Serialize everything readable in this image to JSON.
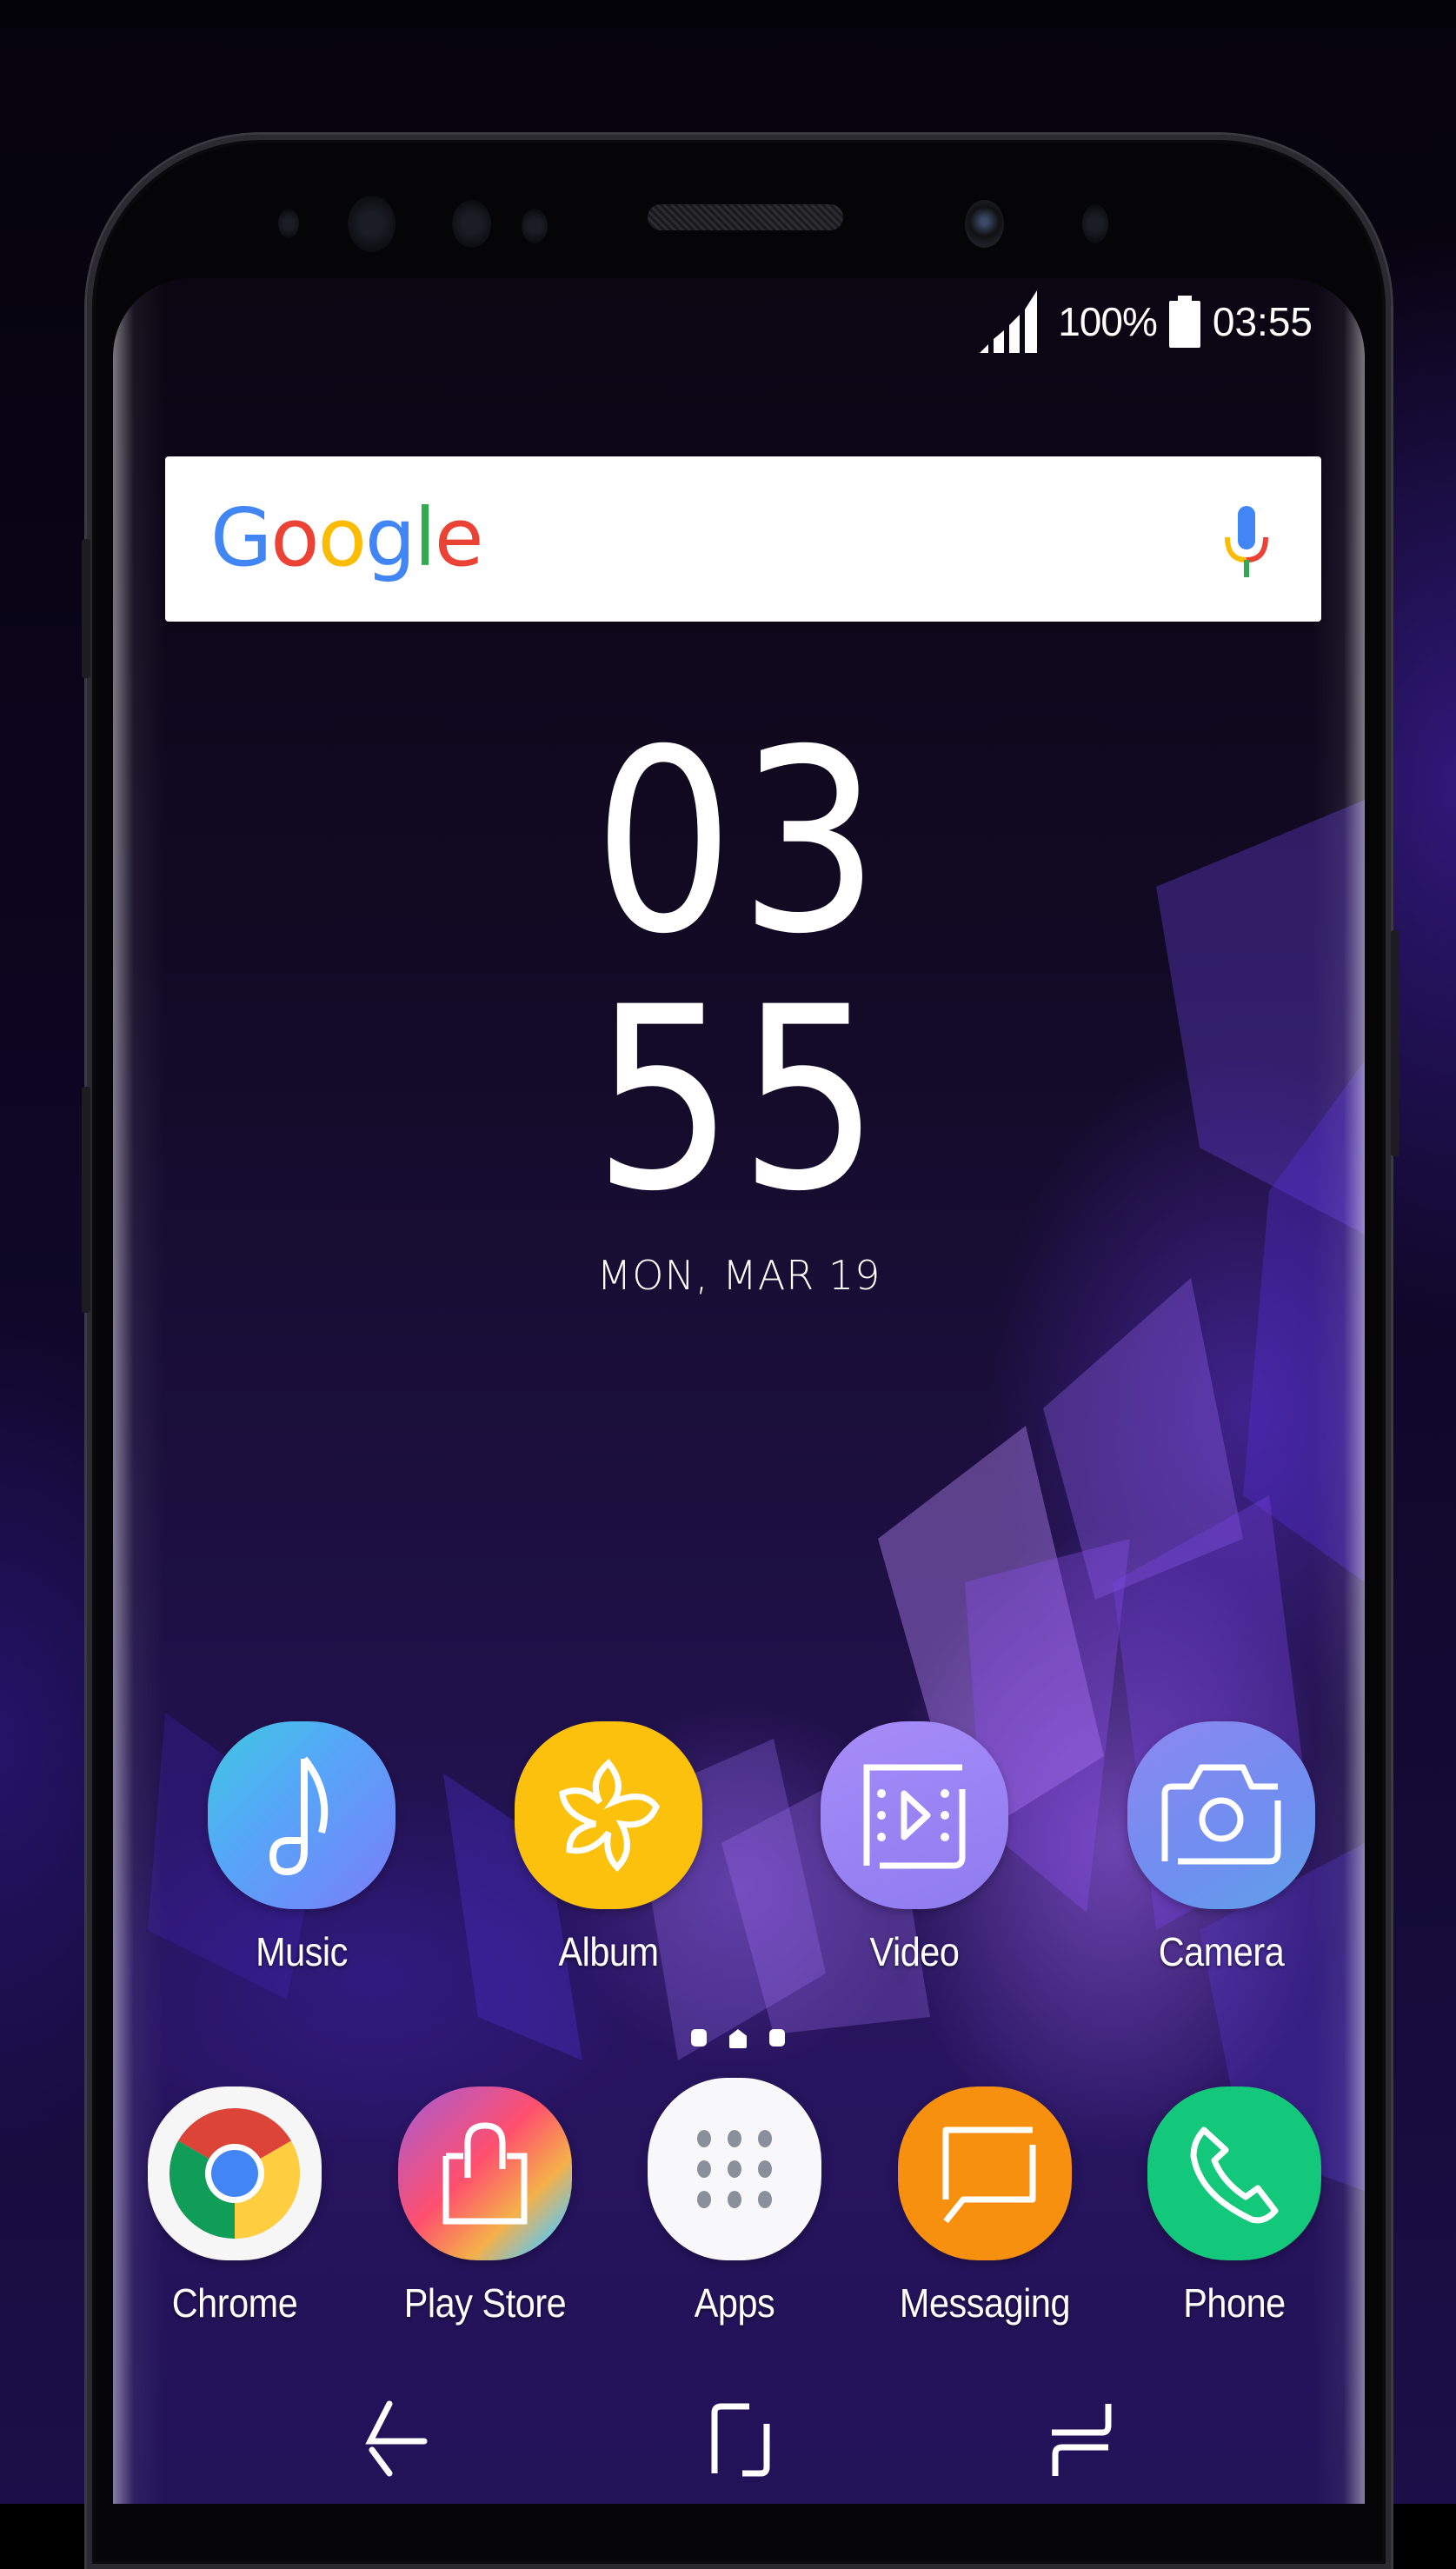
{
  "status_bar": {
    "signal_icon": "cellular-signal-full-icon",
    "battery_percent": "100%",
    "battery_icon": "battery-full-icon",
    "time": "03:55"
  },
  "search_widget": {
    "logo_letters": [
      {
        "char": "G",
        "color": "#4285F4"
      },
      {
        "char": "o",
        "color": "#EA4335"
      },
      {
        "char": "o",
        "color": "#FBBC05"
      },
      {
        "char": "g",
        "color": "#4285F4"
      },
      {
        "char": "l",
        "color": "#34A853"
      },
      {
        "char": "e",
        "color": "#EA4335"
      }
    ],
    "mic_icon": "microphone-icon"
  },
  "clock_widget": {
    "hours": "03",
    "minutes": "55",
    "date": "MON, MAR 19"
  },
  "home_apps": [
    {
      "label": "Music",
      "icon": "music-note-icon",
      "color": "#4aa8f5"
    },
    {
      "label": "Album",
      "icon": "flower-icon",
      "color": "#fcc10c"
    },
    {
      "label": "Video",
      "icon": "video-play-icon",
      "color": "#9a86f5"
    },
    {
      "label": "Camera",
      "icon": "camera-icon",
      "color": "#7a96ec"
    }
  ],
  "page_indicator": {
    "pages": 3,
    "current_is_home": true
  },
  "dock_apps": [
    {
      "label": "Chrome",
      "icon": "chrome-icon",
      "color": "#ffffff"
    },
    {
      "label": "Play Store",
      "icon": "shopping-bag-icon",
      "color": "#e05aa0"
    },
    {
      "label": "Apps",
      "icon": "apps-grid-icon",
      "color": "#ffffff"
    },
    {
      "label": "Messaging",
      "icon": "message-bubble-icon",
      "color": "#f7900f"
    },
    {
      "label": "Phone",
      "icon": "phone-handset-icon",
      "color": "#13c87a"
    }
  ],
  "nav_bar": {
    "back": "back-arrow-icon",
    "home": "home-square-icon",
    "recents": "recents-icon"
  }
}
